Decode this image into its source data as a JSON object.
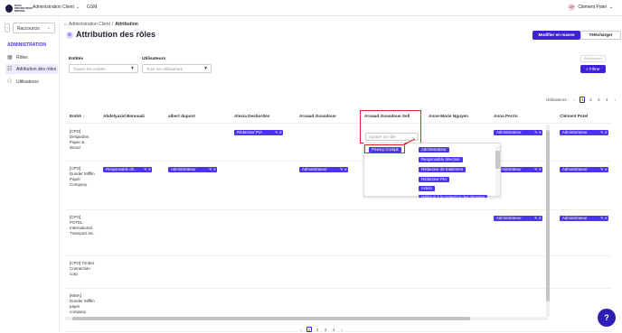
{
  "brand": {
    "logo_text": "DATA PROTECTION DRIVEN"
  },
  "topbar": {
    "menu_label": "Administration Client",
    "gsm_label": "GSM",
    "user_initials": "CP",
    "user_name": "Clément Potel"
  },
  "sidebar": {
    "shortcut_label": "Raccourcis",
    "section_title": "ADMINISTRATION",
    "items": [
      {
        "label": "Rôles",
        "icon": "roles-icon"
      },
      {
        "label": "Attribution des rôles",
        "icon": "assignment-icon"
      },
      {
        "label": "Utilisateurs",
        "icon": "users-icon"
      }
    ]
  },
  "breadcrumb": {
    "home": "Administration Client",
    "current": "Attribution"
  },
  "page": {
    "title": "Attribution des rôles",
    "btn_bulk": "Modifier en masse",
    "btn_download": "Télécharger"
  },
  "filters": {
    "entities_label": "Entités",
    "entities_placeholder": "Toutes les entités",
    "users_label": "Utilisateurs",
    "users_placeholder": "Tous les utilisateurs",
    "reset_label": "Réinitialiser",
    "filter_label": "Filtrer"
  },
  "pagination_top": {
    "label": "Utilisateurs :",
    "pages": [
      "1",
      "2",
      "3",
      "4"
    ],
    "current": "1"
  },
  "table": {
    "entity_header": "Entité",
    "columns": [
      "Abdelyazid Benouali",
      "albert dupont",
      "Alexia Desbordes",
      "Arnaud Goasdoue",
      "Arnaud Goasdoue Sell",
      "Anne-Marie Nguyen",
      "Anna Perrin",
      "Clément Potel"
    ],
    "rows": [
      {
        "entity": "[CPO] Desjardins Paper & Wood",
        "roles": {
          "2": "Rédacteur PIA",
          "6": "Administrateur",
          "7": "Administrateur"
        }
      },
      {
        "entity": "[CPO] Dunder Mifflin Paper Company",
        "roles": {
          "0": "Responsable dir...",
          "1": "Administrateur",
          "3": "Administrateur",
          "6": "Administrateur",
          "7": "Administrateur"
        }
      },
      {
        "entity": "[CPO] POTEL International Transport Inc.",
        "roles": {
          "6": "Administrateur",
          "7": "Administrateur"
        }
      },
      {
        "entity": "[CPO] Timber Connection corp.",
        "roles": {}
      },
      {
        "entity": "[MMA] Dunder Mifflin paper company",
        "roles": {}
      }
    ]
  },
  "role_select": {
    "placeholder": "Ajouter un rôle",
    "selected": "Privacy Cockpit",
    "options": [
      "Administrateur",
      "Responsable direction",
      "Rédacteur de traitement",
      "Rédacteur PIA",
      "Action",
      "Délégué à la protection des données"
    ]
  },
  "pagination_bottom": {
    "pages": [
      "1",
      "2",
      "3",
      "4"
    ],
    "current": "1"
  },
  "colors": {
    "primary": "#3d22d8",
    "chip": "#4a35e8",
    "highlight": "#e0262b"
  }
}
